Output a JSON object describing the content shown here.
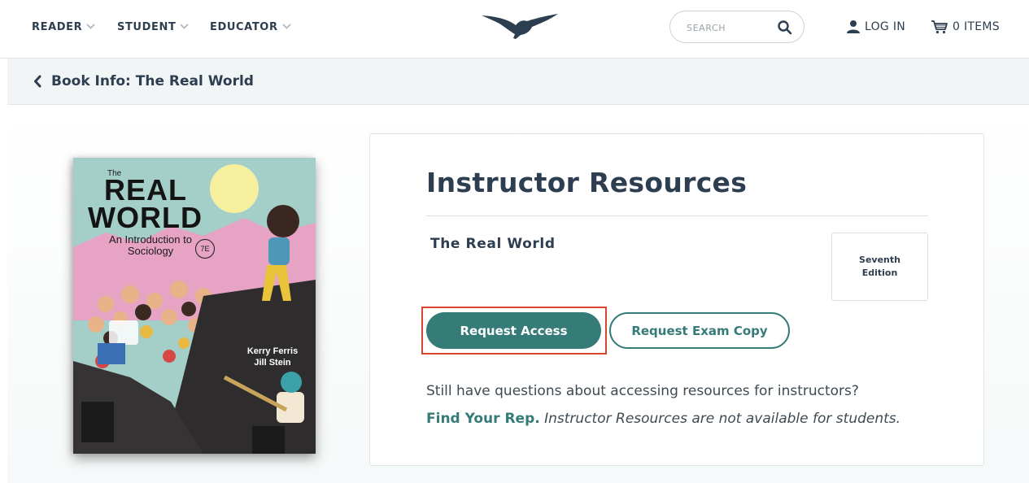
{
  "header": {
    "nav": [
      {
        "label": "READER"
      },
      {
        "label": "STUDENT"
      },
      {
        "label": "EDUCATOR"
      }
    ],
    "logo_icon": "seagull-logo-icon",
    "search": {
      "placeholder": "SEARCH",
      "icon": "search-icon"
    },
    "login_label": "LOG IN",
    "cart_label": "0 ITEMS"
  },
  "breadcrumb": {
    "label": "Book Info: The Real World",
    "icon": "chevron-left-icon"
  },
  "book_cover": {
    "the": "The",
    "title_line1": "REAL",
    "title_line2": "WORLD",
    "subtitle": "An Introduction to Sociology",
    "edition_badge": "7E",
    "author1": "Kerry Ferris",
    "author2": "Jill Stein"
  },
  "panel": {
    "title": "Instructor Resources",
    "book_name": "The Real World",
    "edition": "Seventh Edition",
    "request_access_label": "Request Access",
    "request_exam_copy_label": "Request Exam Copy",
    "question_text": "Still have questions about accessing resources for instructors?",
    "find_rep_label": "Find Your Rep.",
    "student_note": "Instructor Resources are not available for students."
  },
  "colors": {
    "brand_teal": "#357b78",
    "text_dark": "#2c3e50",
    "focus_outline": "#d9452f"
  }
}
